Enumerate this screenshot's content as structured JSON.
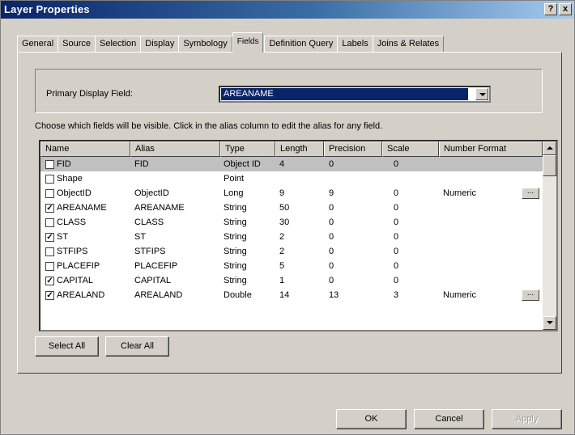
{
  "window": {
    "title": "Layer Properties",
    "help_label": "?",
    "close_label": "x"
  },
  "tabs": [
    {
      "label": "General"
    },
    {
      "label": "Source"
    },
    {
      "label": "Selection"
    },
    {
      "label": "Display"
    },
    {
      "label": "Symbology"
    },
    {
      "label": "Fields"
    },
    {
      "label": "Definition Query"
    },
    {
      "label": "Labels"
    },
    {
      "label": "Joins & Relates"
    }
  ],
  "active_tab": "Fields",
  "primary_display": {
    "label": "Primary Display Field:",
    "value": "AREANAME"
  },
  "instructions": "Choose which fields will be visible. Click in the alias column to edit the alias for any field.",
  "table": {
    "columns": [
      "Name",
      "Alias",
      "Type",
      "Length",
      "Precision",
      "Scale",
      "Number Format"
    ],
    "rows": [
      {
        "checked": false,
        "name": "FID",
        "alias": "FID",
        "type": "Object ID",
        "length": "4",
        "precision": "0",
        "scale": "0",
        "format": "",
        "selected": true
      },
      {
        "checked": false,
        "name": "Shape",
        "alias": "",
        "type": "Point",
        "length": "",
        "precision": "",
        "scale": "",
        "format": ""
      },
      {
        "checked": false,
        "name": "ObjectID",
        "alias": "ObjectID",
        "type": "Long",
        "length": "9",
        "precision": "9",
        "scale": "0",
        "format": "Numeric",
        "ellipsis": true
      },
      {
        "checked": true,
        "name": "AREANAME",
        "alias": "AREANAME",
        "type": "String",
        "length": "50",
        "precision": "0",
        "scale": "0",
        "format": ""
      },
      {
        "checked": false,
        "name": "CLASS",
        "alias": "CLASS",
        "type": "String",
        "length": "30",
        "precision": "0",
        "scale": "0",
        "format": ""
      },
      {
        "checked": true,
        "name": "ST",
        "alias": "ST",
        "type": "String",
        "length": "2",
        "precision": "0",
        "scale": "0",
        "format": ""
      },
      {
        "checked": false,
        "name": "STFIPS",
        "alias": "STFIPS",
        "type": "String",
        "length": "2",
        "precision": "0",
        "scale": "0",
        "format": ""
      },
      {
        "checked": false,
        "name": "PLACEFIP",
        "alias": "PLACEFIP",
        "type": "String",
        "length": "5",
        "precision": "0",
        "scale": "0",
        "format": ""
      },
      {
        "checked": true,
        "name": "CAPITAL",
        "alias": "CAPITAL",
        "type": "String",
        "length": "1",
        "precision": "0",
        "scale": "0",
        "format": ""
      },
      {
        "checked": true,
        "name": "AREALAND",
        "alias": "AREALAND",
        "type": "Double",
        "length": "14",
        "precision": "13",
        "scale": "3",
        "format": "Numeric",
        "ellipsis": true
      }
    ]
  },
  "buttons": {
    "select_all": "Select All",
    "clear_all": "Clear All",
    "ok": "OK",
    "cancel": "Cancel",
    "apply": "Apply",
    "ellipsis": "..."
  },
  "colors": {
    "title_bar": "#0a246a",
    "selection": "#0a246a",
    "face": "#d4d0c8"
  }
}
